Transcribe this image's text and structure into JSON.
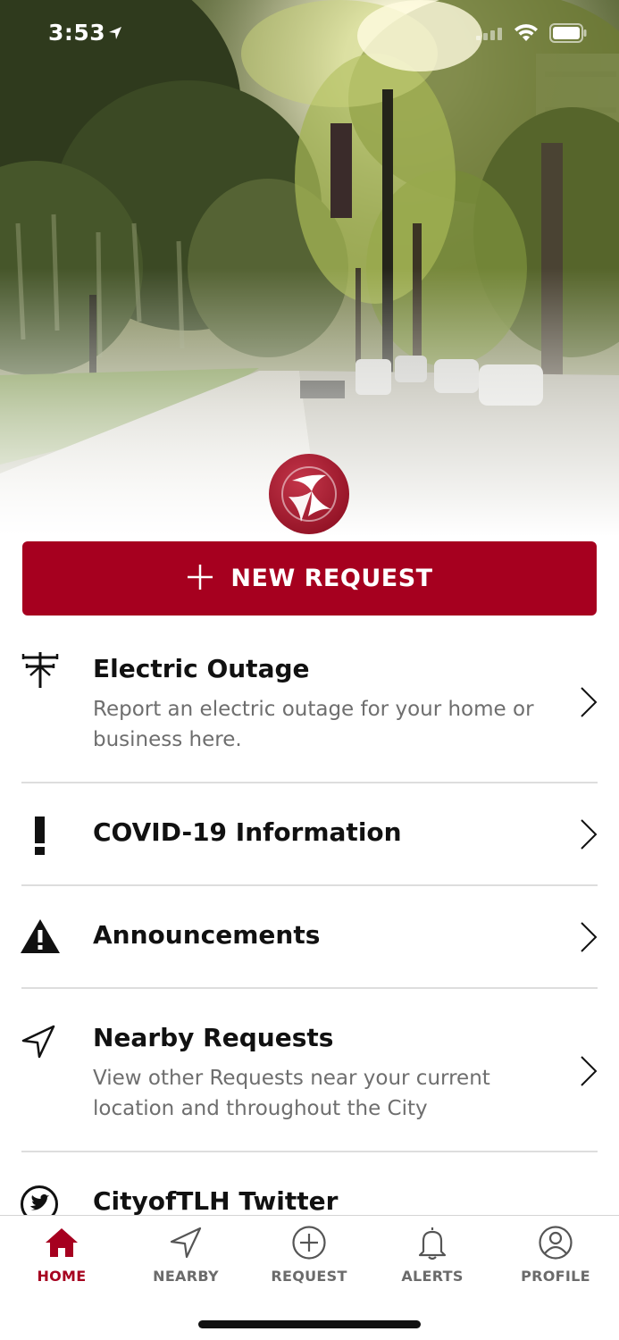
{
  "status_bar": {
    "time": "3:53"
  },
  "brand": {
    "accent_color": "#a6001f",
    "logo_icon": "city-star-logo-icon"
  },
  "actions": {
    "new_request_label": "NEW REQUEST",
    "new_request_icon": "plus-icon"
  },
  "list": {
    "items": [
      {
        "title": "Electric Outage",
        "description": "Report an electric outage for your home or business here.",
        "icon": "power-line-icon"
      },
      {
        "title": "COVID-19 Information",
        "description": "",
        "icon": "exclamation-icon"
      },
      {
        "title": "Announcements",
        "description": "",
        "icon": "warning-triangle-icon"
      },
      {
        "title": "Nearby Requests",
        "description": "View other Requests near your current location and throughout the City",
        "icon": "location-arrow-icon"
      },
      {
        "title": "CityofTLH Twitter",
        "description": "",
        "icon": "twitter-icon"
      }
    ]
  },
  "tabbar": {
    "active": "HOME",
    "tabs": [
      {
        "label": "HOME",
        "icon": "home-icon"
      },
      {
        "label": "NEARBY",
        "icon": "location-arrow-icon"
      },
      {
        "label": "REQUEST",
        "icon": "plus-circle-icon"
      },
      {
        "label": "ALERTS",
        "icon": "bell-icon"
      },
      {
        "label": "PROFILE",
        "icon": "person-circle-icon"
      }
    ]
  }
}
